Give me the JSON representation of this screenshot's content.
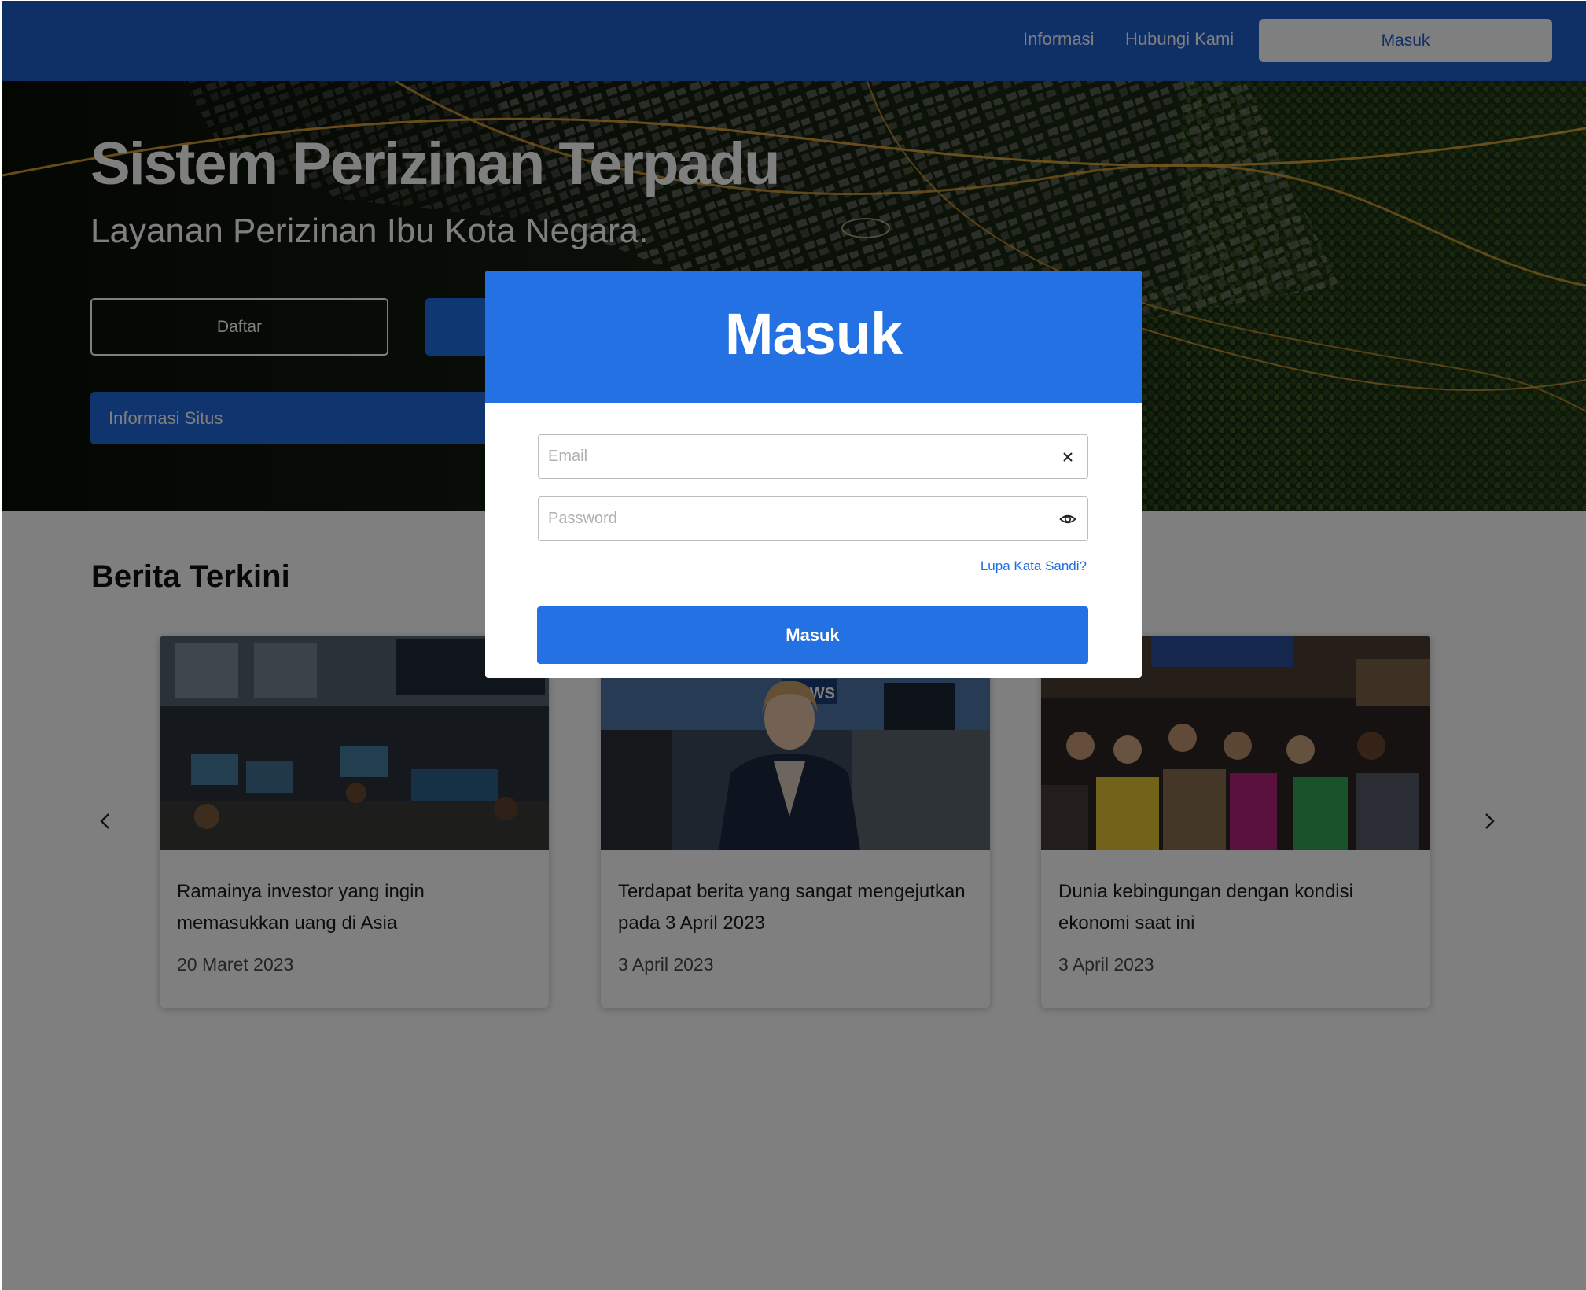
{
  "navbar": {
    "links": [
      "Informasi",
      "Hubungi Kami"
    ],
    "login_button": "Masuk"
  },
  "hero": {
    "title": "Sistem Perizinan Terpadu",
    "subtitle": "Layanan Perizinan Ibu Kota Negara.",
    "register_button": "Daftar",
    "info_button": "Informasi Situs"
  },
  "news": {
    "title": "Berita Terkini",
    "items": [
      {
        "title": "Ramainya investor yang ingin memasukkan uang di Asia",
        "date": "20 Maret 2023"
      },
      {
        "title": "Terdapat berita yang sangat mengejutkan pada 3 April 2023",
        "date": "3 April 2023"
      },
      {
        "title": "Dunia kebingungan dengan kondisi ekonomi saat ini",
        "date": "3 April 2023"
      }
    ],
    "thumb_sign": "NEWS"
  },
  "modal": {
    "title": "Masuk",
    "email_placeholder": "Email",
    "password_placeholder": "Password",
    "forgot_link": "Lupa Kata Sandi?",
    "submit_button": "Masuk"
  },
  "colors": {
    "primary": "#2471e3",
    "navbar": "#1f5fcf",
    "overlay": "rgba(0,0,0,0.5)"
  }
}
